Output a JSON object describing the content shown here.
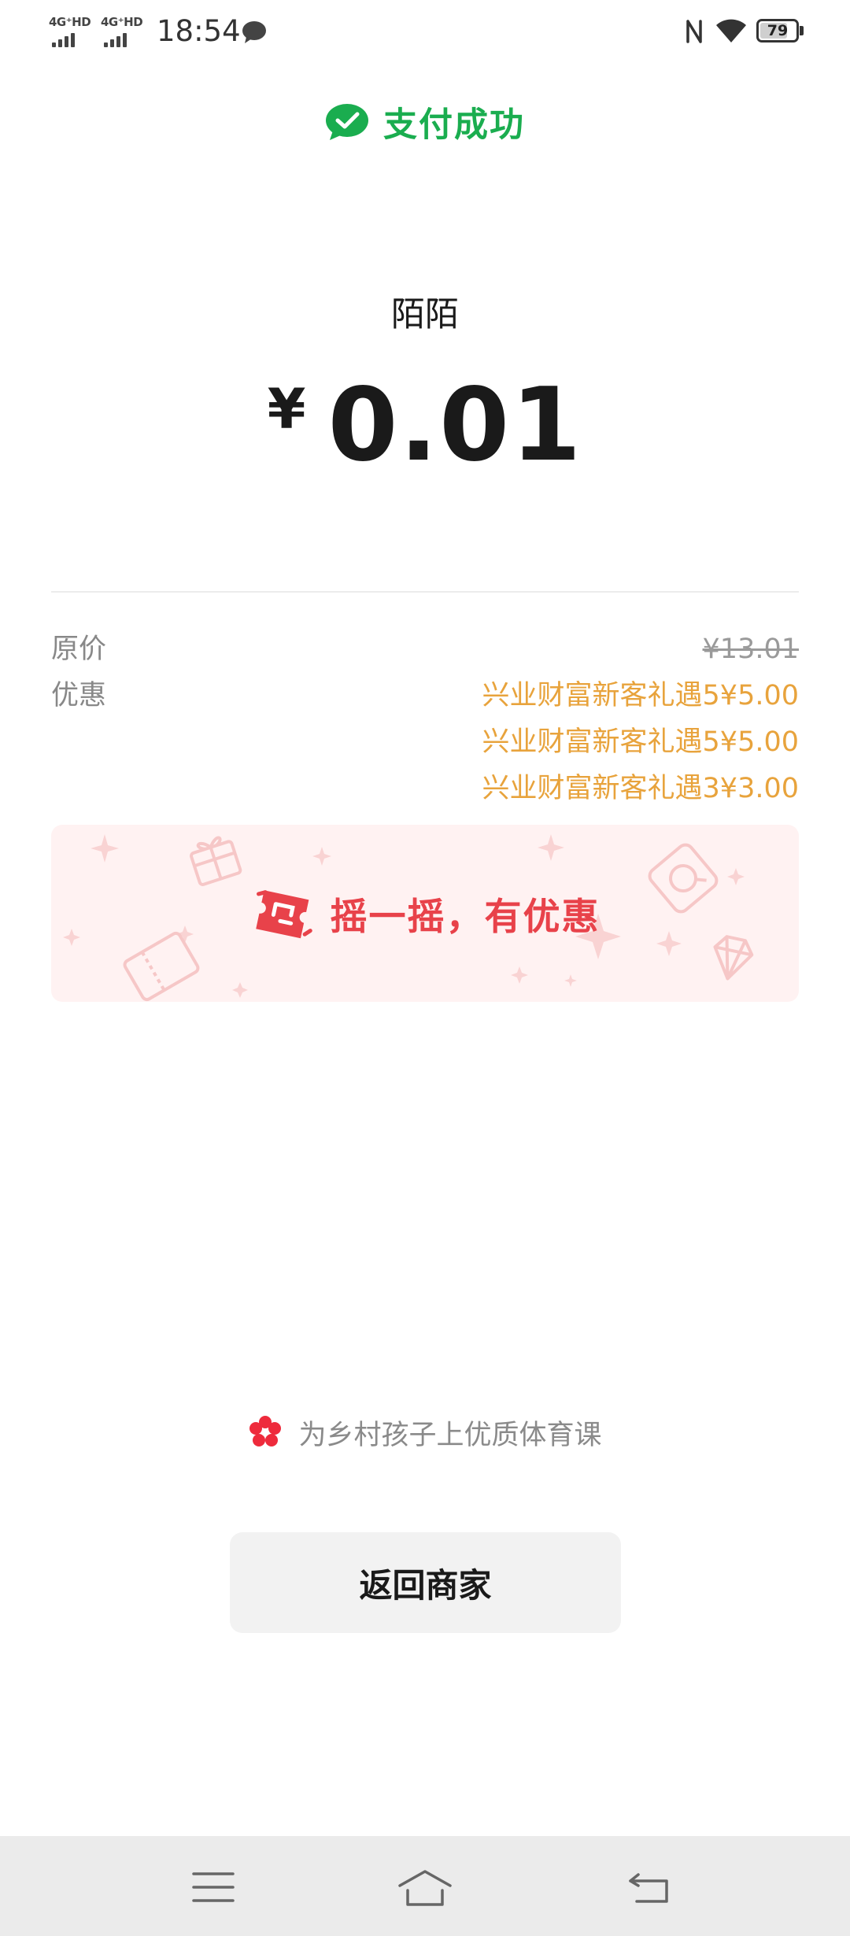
{
  "status_bar": {
    "sim1_label": "4G⁺HD",
    "sim2_label": "4G⁺HD",
    "time": "18:54",
    "battery_level": "79",
    "battery_fraction": 0.79
  },
  "header": {
    "status_text": "支付成功",
    "brand_color": "#1aad4f"
  },
  "payment": {
    "merchant": "陌陌",
    "currency_symbol": "¥",
    "amount": "0.01"
  },
  "details": {
    "original_price_label": "原价",
    "original_price_value": "¥13.01",
    "discount_label": "优惠",
    "discounts": [
      "兴业财富新客礼遇5¥5.00",
      "兴业财富新客礼遇5¥5.00",
      "兴业财富新客礼遇3¥3.00"
    ],
    "discount_color": "#e8a33c"
  },
  "banner": {
    "text": "摇一摇，有优惠",
    "accent_color": "#e8424a"
  },
  "charity": {
    "text": "为乡村孩子上优质体育课"
  },
  "actions": {
    "return_label": "返回商家"
  },
  "icons": {
    "header": "wechat-pay-check-icon",
    "banner": "shake-coupon-icon",
    "charity": "red-flower-icon",
    "nav": [
      "menu-icon",
      "home-icon",
      "back-icon"
    ]
  }
}
